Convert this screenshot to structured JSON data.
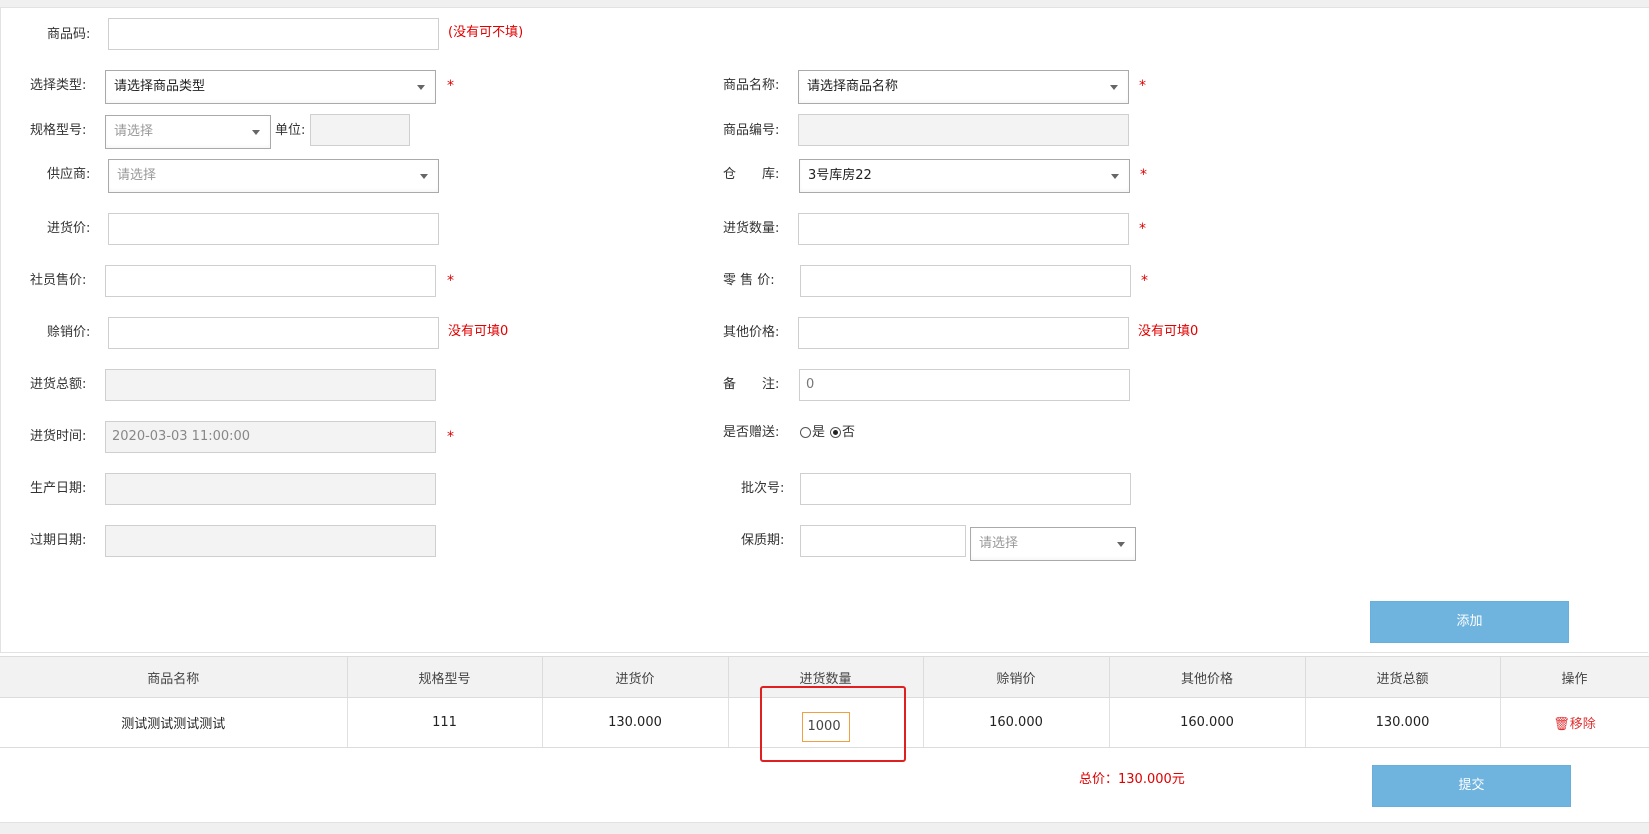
{
  "form": {
    "barcode": {
      "label": "商品码:",
      "value": "",
      "note": "(没有可不填)"
    },
    "type": {
      "label": "选择类型:",
      "value": "请选择商品类型",
      "required": "*"
    },
    "product_name": {
      "label": "商品名称:",
      "value": "请选择商品名称",
      "required": "*"
    },
    "spec": {
      "label": "规格型号:",
      "value": "请选择"
    },
    "unit": {
      "label": "单位:",
      "value": ""
    },
    "product_code": {
      "label": "商品编号:",
      "value": ""
    },
    "supplier": {
      "label": "供应商:",
      "value": "请选择"
    },
    "warehouse": {
      "label": "仓　　库:",
      "value": "3号库房22",
      "required": "*"
    },
    "purchase_price": {
      "label": "进货价:",
      "value": ""
    },
    "purchase_qty": {
      "label": "进货数量:",
      "value": "",
      "required": "*"
    },
    "member_price": {
      "label": "社员售价:",
      "value": "",
      "required": "*"
    },
    "retail_price": {
      "label": "零 售 价:",
      "value": "",
      "required": "*"
    },
    "credit_price": {
      "label": "赊销价:",
      "value": "",
      "note": "没有可填0"
    },
    "other_price": {
      "label": "其他价格:",
      "value": "",
      "note": "没有可填0"
    },
    "total_amount": {
      "label": "进货总额:",
      "value": ""
    },
    "remark": {
      "label": "备　　注:",
      "value": "0"
    },
    "purchase_time": {
      "label": "进货时间:",
      "value": "2020-03-03 11:00:00",
      "required": "*"
    },
    "gift": {
      "label": "是否赠送:",
      "yes": "是",
      "no": "否",
      "selected": "否"
    },
    "production_date": {
      "label": "生产日期:",
      "value": ""
    },
    "batch_no": {
      "label": "批次号:",
      "value": ""
    },
    "expiry_date": {
      "label": "过期日期:",
      "value": ""
    },
    "shelf_life": {
      "label": "保质期:",
      "value": "",
      "unit_value": "请选择"
    },
    "add_button": "添加"
  },
  "table": {
    "headers": [
      "商品名称",
      "规格型号",
      "进货价",
      "进货数量",
      "赊销价",
      "其他价格",
      "进货总额",
      "操作"
    ],
    "rows": [
      {
        "name": "测试测试测试测试",
        "spec": "111",
        "price": "130.000",
        "qty": "1000",
        "credit": "160.000",
        "other": "160.000",
        "total": "130.000",
        "action": "🗑移除"
      }
    ]
  },
  "summary": {
    "total": "总价：130.000元",
    "submit_button": "提交"
  },
  "colors": {
    "required": "#e00000",
    "button": "#6fb3df",
    "highlight": "#e02020"
  }
}
